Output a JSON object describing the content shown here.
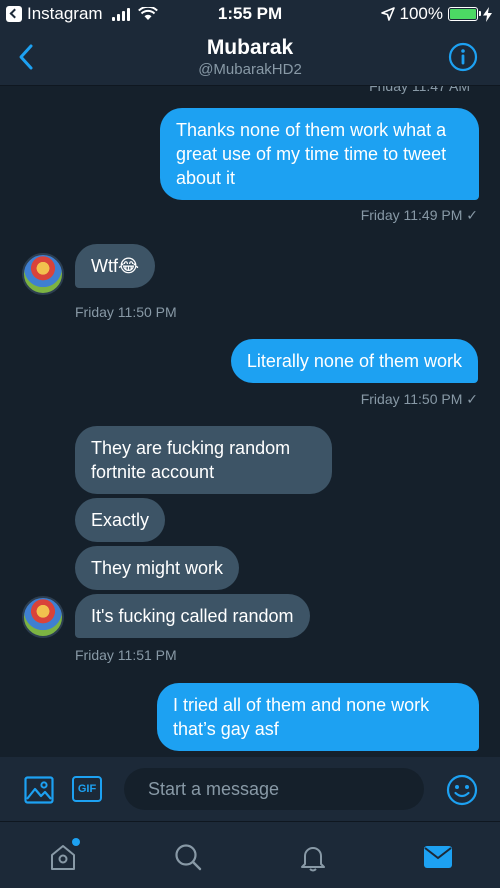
{
  "status_bar": {
    "back_app": "Instagram",
    "time": "1:55 PM",
    "battery": "100%",
    "battery_level": 1.0
  },
  "header": {
    "title": "Mubarak",
    "handle": "@MubarakHD2"
  },
  "conversation": {
    "partial_timestamp": "Friday 11:47 AM",
    "messages": [
      {
        "direction": "outgoing",
        "text": "Thanks none of them work what a great use of my time time to tweet about it"
      },
      {
        "direction": "incoming",
        "text": "Wtf😂"
      },
      {
        "direction": "outgoing",
        "text": "Literally none of them work"
      },
      {
        "direction": "incoming",
        "text": "They are fucking random fortnite account"
      },
      {
        "direction": "incoming",
        "text": "Exactly"
      },
      {
        "direction": "incoming",
        "text": "They might work"
      },
      {
        "direction": "incoming",
        "text": "It's fucking called random"
      },
      {
        "direction": "outgoing",
        "text": "I tried all of them and none work that’s gay asf"
      }
    ],
    "timestamps": [
      "Friday 11:49 PM ✓",
      "Friday 11:50 PM",
      "Friday 11:50 PM ✓",
      "Friday 11:51 PM"
    ]
  },
  "composer": {
    "placeholder": "Start a message",
    "gif_label": "GIF"
  },
  "tabbar": {
    "items": [
      "home-icon",
      "search-icon",
      "bell-icon",
      "mail-icon"
    ],
    "active": "mail-icon"
  },
  "colors": {
    "background": "#15202b",
    "bar": "#1c2938",
    "accent": "#1da1f2",
    "incoming_bubble": "#3d5466",
    "muted_text": "#8899a6"
  }
}
